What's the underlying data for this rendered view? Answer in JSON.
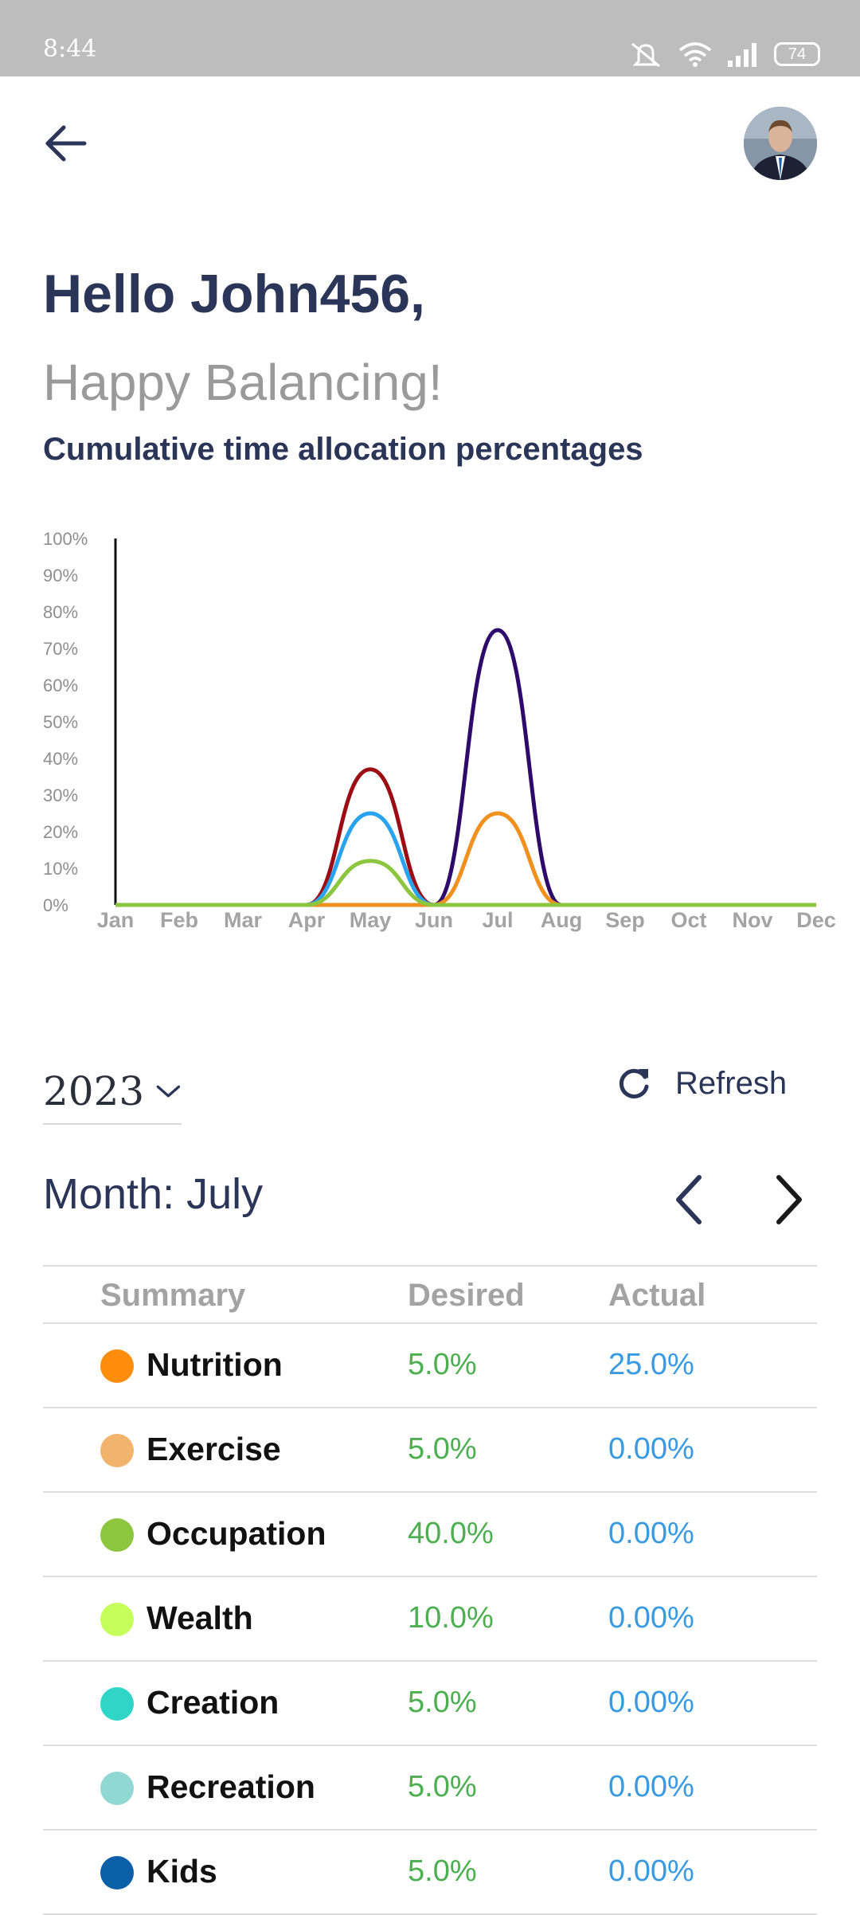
{
  "status": {
    "time": "8:44",
    "battery": "74"
  },
  "header": {
    "greeting": "Hello John456,",
    "subtitle": "Happy Balancing!"
  },
  "chart_data": {
    "type": "line",
    "title": "Cumulative time allocation percentages",
    "categories": [
      "Jan",
      "Feb",
      "Mar",
      "Apr",
      "May",
      "Jun",
      "Jul",
      "Aug",
      "Sep",
      "Oct",
      "Nov",
      "Dec"
    ],
    "yticks": [
      "0%",
      "10%",
      "20%",
      "30%",
      "40%",
      "50%",
      "60%",
      "70%",
      "80%",
      "90%",
      "100%"
    ],
    "ylim": [
      0,
      100
    ],
    "series": [
      {
        "color": "#2e0a6b",
        "values": [
          0,
          0,
          0,
          0,
          0,
          0,
          75,
          0,
          0,
          0,
          0,
          0
        ]
      },
      {
        "color": "#f0901e",
        "values": [
          0,
          0,
          0,
          0,
          0,
          0,
          25,
          0,
          0,
          0,
          0,
          0
        ]
      },
      {
        "color": "#9b0d12",
        "values": [
          0,
          0,
          0,
          0,
          37,
          0,
          0,
          0,
          0,
          0,
          0,
          0
        ]
      },
      {
        "color": "#2aa3ee",
        "values": [
          0,
          0,
          0,
          0,
          25,
          0,
          0,
          0,
          0,
          0,
          0,
          0
        ]
      },
      {
        "color": "#8cc63f",
        "values": [
          0,
          0,
          0,
          0,
          12,
          0,
          0,
          0,
          0,
          0,
          0,
          0
        ]
      }
    ],
    "grid": false
  },
  "controls": {
    "year": "2023",
    "refresh_label": "Refresh",
    "month_label": "Month: July"
  },
  "table": {
    "headers": [
      "Summary",
      "Desired",
      "Actual"
    ],
    "rows": [
      {
        "name": "Nutrition",
        "desired": "5.0%",
        "actual": "25.0%",
        "color": "#ff8c0a"
      },
      {
        "name": "Exercise",
        "desired": "5.0%",
        "actual": "0.00%",
        "color": "#f2b36c"
      },
      {
        "name": "Occupation",
        "desired": "40.0%",
        "actual": "0.00%",
        "color": "#8cc63f"
      },
      {
        "name": "Wealth",
        "desired": "10.0%",
        "actual": "0.00%",
        "color": "#c5ff5a"
      },
      {
        "name": "Creation",
        "desired": "5.0%",
        "actual": "0.00%",
        "color": "#2fd6c8"
      },
      {
        "name": "Recreation",
        "desired": "5.0%",
        "actual": "0.00%",
        "color": "#92d8d2"
      },
      {
        "name": "Kids",
        "desired": "5.0%",
        "actual": "0.00%",
        "color": "#0b5fa8"
      }
    ]
  }
}
